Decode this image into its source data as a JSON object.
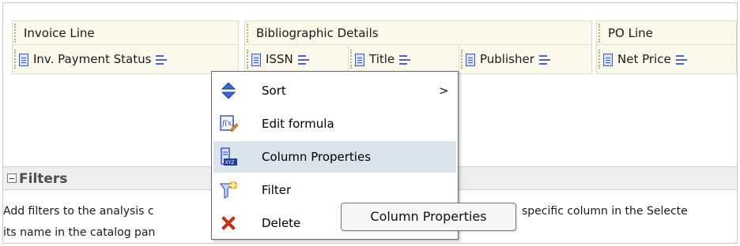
{
  "criteria": {
    "groups": [
      {
        "label": "Invoice Line"
      },
      {
        "label": "Bibliographic Details"
      },
      {
        "label": "PO Line"
      }
    ],
    "columns": [
      {
        "label": "Inv. Payment Status"
      },
      {
        "label": "ISSN"
      },
      {
        "label": "Title"
      },
      {
        "label": "Publisher"
      },
      {
        "label": "Net Price"
      }
    ]
  },
  "context_menu": {
    "items": [
      {
        "label": "Sort",
        "icon": "sort-icon",
        "submenu_arrow": ">"
      },
      {
        "label": "Edit formula",
        "icon": "edit-formula-icon"
      },
      {
        "label": "Column Properties",
        "icon": "column-properties-icon",
        "highlighted": true
      },
      {
        "label": "Filter",
        "icon": "filter-icon"
      },
      {
        "label": "Delete",
        "icon": "delete-icon"
      }
    ]
  },
  "filters": {
    "title": "Filters",
    "help_line1_start": "Add filters to the analysis c",
    "help_line1_end": "specific column in the Selecte",
    "help_line2": "its name in the catalog pan"
  },
  "tooltip": {
    "text": "Column Properties"
  },
  "colors": {
    "menu_highlight": "#dbe3ec",
    "group_bg": "#fbf8ec",
    "icon_blue": "#3d57c4",
    "delete_red": "#e03a1a"
  }
}
